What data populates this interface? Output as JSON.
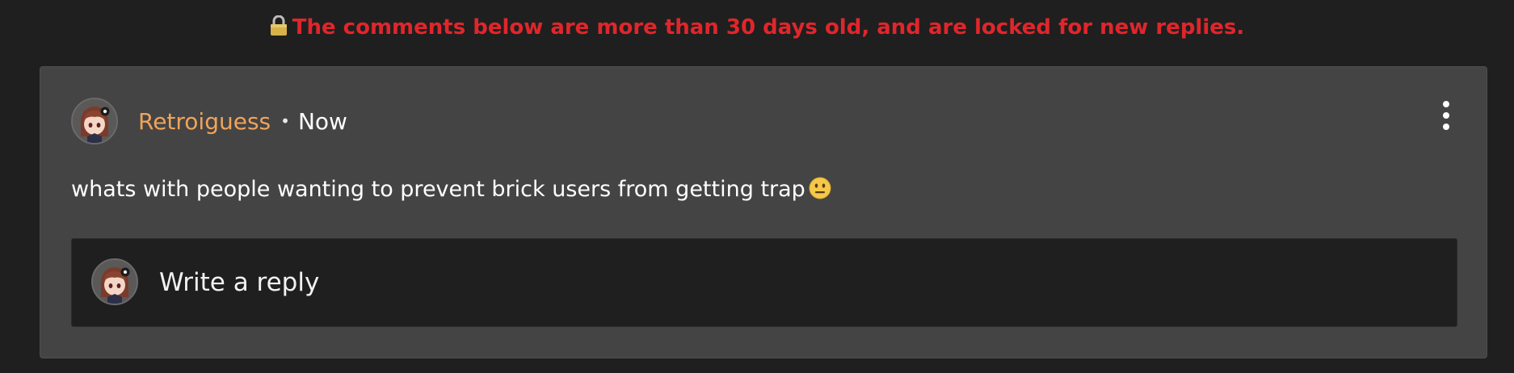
{
  "colors": {
    "page_bg": "#1f1f1f",
    "card_bg": "#444444",
    "notice_text": "#e0262b",
    "author_name": "#f0a45a",
    "text": "#ffffff"
  },
  "notice": {
    "icon": "lock-icon",
    "text": "The comments below are more than 30 days old, and are locked for new replies."
  },
  "comment": {
    "avatar_icon": "user-avatar",
    "author": "Retroiguess",
    "separator": "•",
    "time": "Now",
    "menu_icon": "kebab-menu-icon",
    "body": "whats with people wanting to prevent brick users from getting trap",
    "emoji": "neutral-face-emoji"
  },
  "reply": {
    "avatar_icon": "user-avatar",
    "placeholder": "Write a reply"
  }
}
